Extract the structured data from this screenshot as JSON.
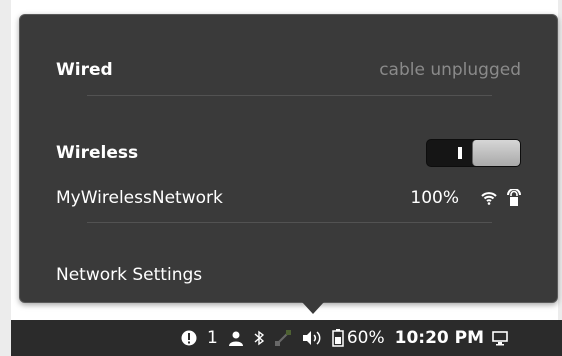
{
  "menu": {
    "wired": {
      "label": "Wired",
      "status": "cable unplugged"
    },
    "wireless": {
      "label": "Wireless",
      "toggle_on_label": "I",
      "enabled": true
    },
    "network": {
      "name": "MyWirelessNetwork",
      "signal_strength": "100%",
      "signal_icon": "wifi-signal-icon",
      "secure_icon": "lock-icon"
    },
    "settings_label": "Network Settings"
  },
  "panel": {
    "notifications_icon": "alert-icon",
    "notification_count": "1",
    "user_icon": "user-icon",
    "bluetooth_icon": "bluetooth-icon",
    "network_icon": "network-disconnected-icon",
    "volume_icon": "volume-icon",
    "battery_icon": "battery-icon",
    "battery_level": "60%",
    "time": "10:20 PM",
    "display_icon": "display-icon"
  },
  "colors": {
    "menu_bg": "#3a3a3a",
    "panel_bg": "#2b2b2b",
    "text": "#ffffff",
    "muted_text": "#8a8a8a"
  }
}
